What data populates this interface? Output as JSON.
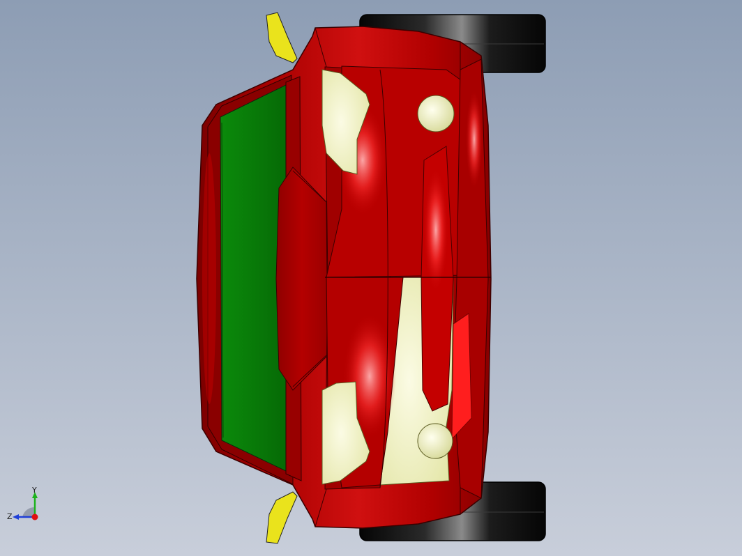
{
  "viewport": {
    "background_top": "#8d9db4",
    "background_bottom": "#c8ceda"
  },
  "model": {
    "body_color": "#b80000",
    "body_highlight": "#ff3a3a",
    "windshield_color": "#0a7a0a",
    "bumper_color": "#f4f6cf",
    "mirror_color": "#e8e020",
    "tire_color": "#0c0c0c"
  },
  "triad": {
    "y_label": "Y",
    "z_label": "Z",
    "y_color": "#1db31d",
    "z_color": "#1f3fd8",
    "x_color": "#e01010"
  }
}
